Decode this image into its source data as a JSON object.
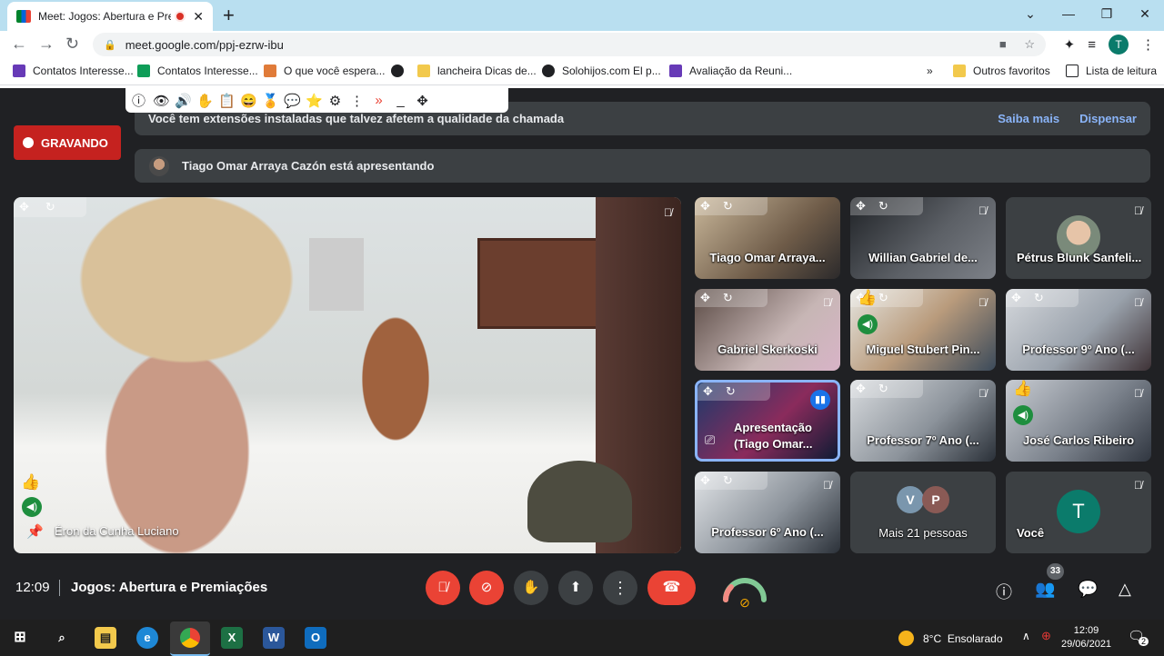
{
  "browser": {
    "tab_title": "Meet: Jogos: Abertura e Prem",
    "url": "meet.google.com/ppj-ezrw-ibu",
    "profile_initial": "T",
    "new_tab_label": "+"
  },
  "bookmarks": [
    {
      "label": "Contatos Interesse...",
      "color": "#673ab7"
    },
    {
      "label": "Contatos Interesse...",
      "color": "#0f9d58"
    },
    {
      "label": "O que você espera...",
      "color": "#e07b39"
    },
    {
      "label": "",
      "color": "#202124"
    },
    {
      "label": "lancheira Dicas de...",
      "color": "#f2c94c"
    },
    {
      "label": "Solohijos.com  El p...",
      "color": "#202124"
    },
    {
      "label": "Avaliação da Reuni...",
      "color": "#673ab7"
    }
  ],
  "bookmarks_right": {
    "more": "»",
    "other": "Outros favoritos",
    "reading_list": "Lista de leitura"
  },
  "notice": {
    "message": "Você tem extensões instaladas que talvez afetem a qualidade da chamada",
    "learn_more": "Saiba mais",
    "dismiss": "Dispensar"
  },
  "presenting_text": "Tiago Omar Arraya Cazón está apresentando",
  "recording_label": "GRAVANDO",
  "main_speaker": "Éron da Cunha Luciano",
  "tiles": [
    {
      "name": "Tiago Omar Arraya..."
    },
    {
      "name": "Willian Gabriel de..."
    },
    {
      "name": "Pétrus Blunk Sanfeli..."
    },
    {
      "name": "Gabriel Skerkoski"
    },
    {
      "name": "Miguel Stubert Pin..."
    },
    {
      "name": "Professor 9º Ano (..."
    },
    {
      "name": "Apresentação",
      "name2": "(Tiago Omar..."
    },
    {
      "name": "Professor 7º Ano (..."
    },
    {
      "name": "José Carlos Ribeiro"
    },
    {
      "name": "Professor 6º Ano (..."
    },
    {
      "name": "Mais 21 pessoas",
      "initials": [
        "V",
        "P"
      ]
    },
    {
      "name": "Você",
      "initial": "T"
    }
  ],
  "bottom": {
    "time": "12:09",
    "meeting_title": "Jogos: Abertura e Premiações",
    "participant_count": "33"
  },
  "taskbar": {
    "weather_temp": "8°C",
    "weather_desc": "Ensolarado",
    "time": "12:09",
    "date": "29/06/2021",
    "notifications": "2"
  },
  "colors": {
    "meet_bg": "#202124",
    "recording": "#c5221f",
    "hangup": "#ea4335",
    "link": "#8ab4f8",
    "speaking": "#1e8e3e"
  }
}
